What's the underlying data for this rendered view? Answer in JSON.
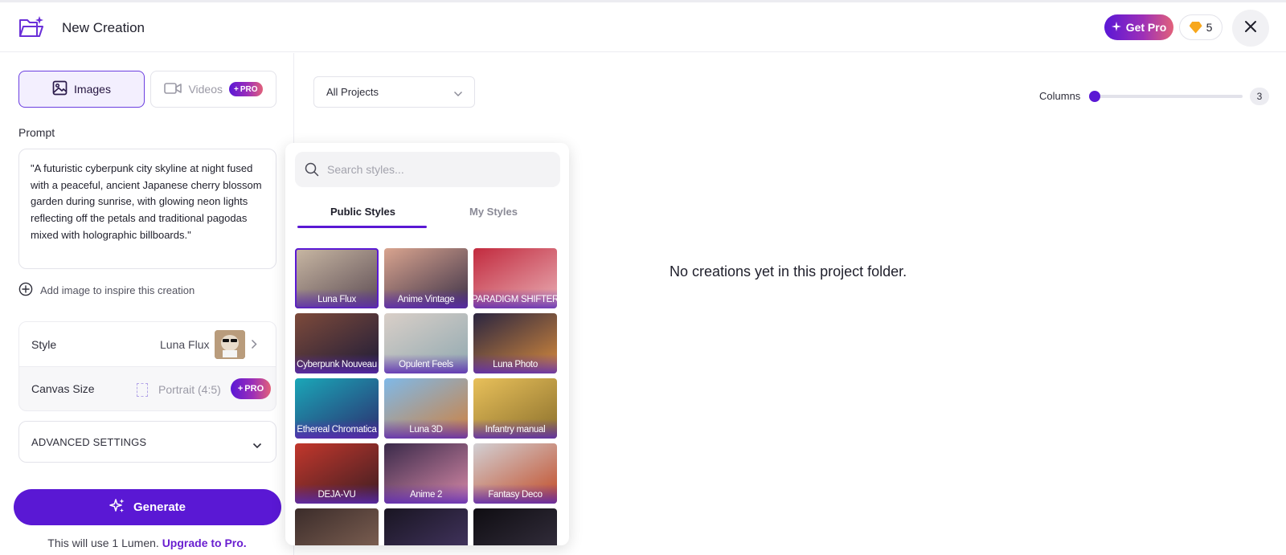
{
  "header": {
    "title": "New Creation",
    "get_pro_label": "Get Pro",
    "lumens_count": "5"
  },
  "left": {
    "modes": {
      "images": "Images",
      "videos": "Videos",
      "pro_badge": "PRO"
    },
    "prompt_label": "Prompt",
    "prompt_text": "\"A futuristic cyberpunk city skyline at night fused with a peaceful, ancient Japanese cherry blossom garden during sunrise, with glowing neon lights reflecting off the petals and traditional pagodas mixed with holographic billboards.\"",
    "add_image_label": "Add image to inspire this creation",
    "style_label": "Style",
    "style_value": "Luna Flux",
    "canvas_label": "Canvas Size",
    "canvas_value": "Portrait (4:5)",
    "canvas_pro": "PRO",
    "advanced_label": "ADVANCED SETTINGS",
    "generate_label": "Generate",
    "lumen_note": "This will use 1 Lumen.",
    "upgrade_link": "Upgrade to Pro."
  },
  "main": {
    "projects_selected": "All Projects",
    "columns_label": "Columns",
    "columns_value": "3",
    "columns_slider_level": 0.0,
    "empty_message": "No creations yet in this project folder."
  },
  "styles_popover": {
    "search_placeholder": "Search styles...",
    "tabs": {
      "public": "Public Styles",
      "mine": "My Styles"
    },
    "selected": "Luna Flux",
    "tiles": [
      {
        "name": "Luna Flux",
        "colors": [
          "#c9b8a4",
          "#5b4a52"
        ]
      },
      {
        "name": "Anime Vintage",
        "colors": [
          "#d9a48f",
          "#3a3046"
        ]
      },
      {
        "name": "PARADIGM SHIFTER",
        "colors": [
          "#c22a3e",
          "#e9b0b6"
        ]
      },
      {
        "name": "Cyberpunk Nouveau",
        "colors": [
          "#7d4a3a",
          "#1c1b38"
        ]
      },
      {
        "name": "Opulent Feels",
        "colors": [
          "#d9cfc8",
          "#8fa8b0"
        ]
      },
      {
        "name": "Luna Photo",
        "colors": [
          "#2a2540",
          "#d98c3c"
        ]
      },
      {
        "name": "Ethereal Chromatica",
        "colors": [
          "#1aa7b8",
          "#2c2d6e"
        ]
      },
      {
        "name": "Luna 3D",
        "colors": [
          "#7fb9e8",
          "#d0803d"
        ]
      },
      {
        "name": "Infantry manual",
        "colors": [
          "#e8c05a",
          "#8a6f2c"
        ]
      },
      {
        "name": "DEJA-VU",
        "colors": [
          "#c2372c",
          "#3b1d22"
        ]
      },
      {
        "name": "Anime 2",
        "colors": [
          "#3a2a4a",
          "#d88aa8"
        ]
      },
      {
        "name": "Fantasy Deco",
        "colors": [
          "#d2d0d4",
          "#c24a24"
        ]
      },
      {
        "name": "",
        "colors": [
          "#3b2c2a",
          "#8a6a5a"
        ]
      },
      {
        "name": "",
        "colors": [
          "#191522",
          "#4a3a6a"
        ]
      },
      {
        "name": "",
        "colors": [
          "#0f0d12",
          "#3a3444"
        ]
      }
    ]
  }
}
